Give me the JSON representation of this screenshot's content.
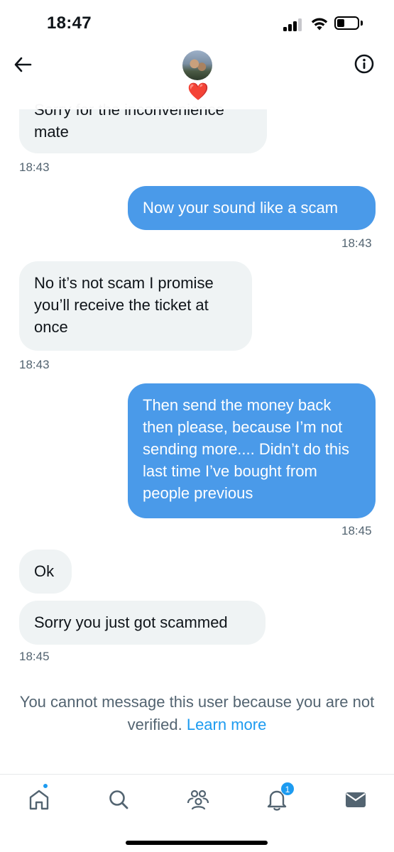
{
  "status_bar": {
    "time": "18:47"
  },
  "header": {
    "avatar_badge": "❤️"
  },
  "messages": [
    {
      "direction": "in",
      "text": "Sorry for the inconvenience mate",
      "time": "18:43"
    },
    {
      "direction": "out",
      "text": "Now your sound like a scam",
      "time": "18:43"
    },
    {
      "direction": "in",
      "text": "No it’s not scam I promise you’ll receive the ticket at once",
      "time": "18:43"
    },
    {
      "direction": "out",
      "text": "Then send the money back then please, because I’m not sending more.... Didn’t do this last time I’ve bought from people previous",
      "time": "18:45"
    },
    {
      "direction": "in",
      "text": "Ok"
    },
    {
      "direction": "in",
      "text": "Sorry you just got scammed",
      "time": "18:45"
    }
  ],
  "notice": {
    "text": "You cannot message this user because you are not verified.",
    "link_label": "Learn more"
  },
  "bottom_nav": {
    "items": [
      "home-icon",
      "search-icon",
      "communities-icon",
      "notifications-icon",
      "messages-icon"
    ],
    "notifications_count": "1",
    "accent_color": "#1d9bf0"
  },
  "colors": {
    "incoming_bubble": "#eff3f4",
    "outgoing_bubble": "#4a9ae9",
    "timestamp": "#536471"
  }
}
